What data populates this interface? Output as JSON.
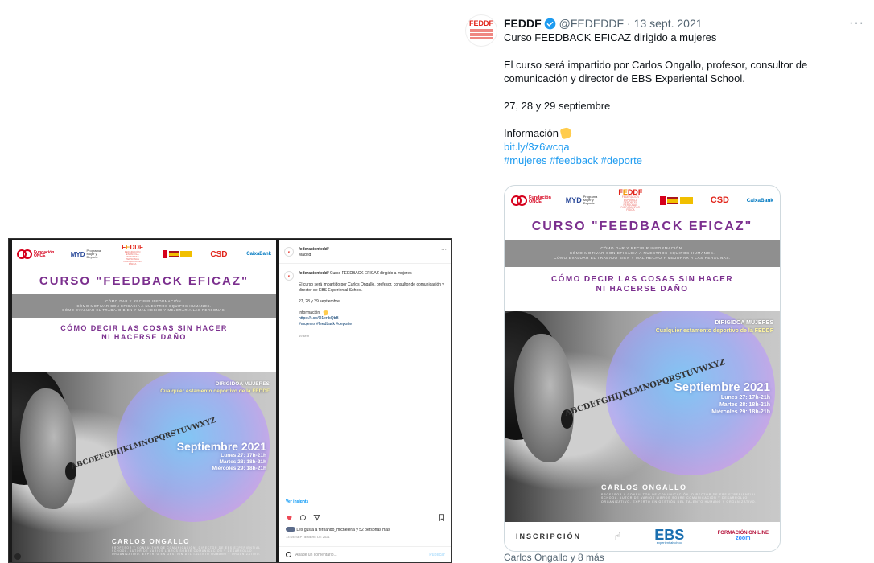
{
  "tweet": {
    "name": "FEDDF",
    "handle": "@FEDEDDF",
    "separator": "·",
    "date": "13 sept. 2021",
    "more_label": "···",
    "title_line": "Curso FEEDBACK EFICAZ dirigido a mujeres",
    "paragraph": "El curso será impartido por Carlos Ongallo, profesor, consultor de comunicación y director de EBS Experiental School.",
    "dates": "27, 28 y 29 septiembre",
    "info_label": "Información",
    "link": "bit.ly/3z6wcqa",
    "hashtags": "#mujeres #feedback #deporte",
    "tagged": "Carlos Ongallo y 8 más",
    "avatar_logo_text": "FEDDF"
  },
  "poster": {
    "logo_once": "Fundación ONCE",
    "logo_myd": "MYD",
    "logo_myd_sub": "Programa Mujer y Deporte",
    "logo_feddf": "FEDDF",
    "logo_feddf_sub": "FEDERACIÓN ESPAÑOLA DEPORTES PERSONAS DISCAPACIDAD FÍSICA",
    "logo_csd": "CSD",
    "logo_caixa": "CaixaBank",
    "title": "CURSO \"FEEDBACK EFICAZ\"",
    "band_line1": "CÓMO DAR Y RECIBIR INFORMACIÓN.",
    "band_line2": "CÓMO MOTIVAR CON EFICACIA A NUESTROS EQUIPOS HUMANOS.",
    "band_line3": "CÓMO EVALUAR EL TRABAJO BIEN Y MAL HECHO Y MEJORAR A LAS PERSONAS.",
    "subtitle_line1": "CÓMO DECIR LAS COSAS SIN HACER",
    "subtitle_line2": "NI HACERSE DAÑO",
    "dirigida": "DIRIGIDOA MUJERES",
    "estamento": "Cualquier estamento deportivo de la  FEDDF",
    "month": "Septiembre 2021",
    "day1": "Lunes 27: 17h-21h",
    "day2": "Martes 28: 18h-21h",
    "day3": "Miércoles 29: 18h-21h",
    "speaker": "CARLOS ONGALLO",
    "speaker_bio": "PROFESOR Y CONSULTOR DE COMUNICACIÓN. DIRECTOR DE EBS EXPERIENTIAL SCHOOL. AUTOR DE VARIOS LIBROS SOBRE COMUNICACIÓN Y DESARROLLO ORGANIZATIVO. EXPERTO EN GESTIÓN DEL TALENTO HUMANO Y ORGANIZATIVO.",
    "inscripcion": "INSCRIPCIÓN",
    "ebs": "EBS",
    "ebs_sub": "experientialschool",
    "formacion": "FORMACIÓN ON-LINE",
    "zoom": "zoom",
    "letters": "ABCDEFGHIJKLMNOPQRSTUVWXYZ"
  },
  "instagram": {
    "account": "federacionfeddf",
    "location": "Madrid",
    "more_label": "···",
    "caption_intro": "Curso FEEDBACK EFICAZ dirigido a mujeres",
    "caption_body": "El curso será impartido por Carlos Ongallo, profesor, consultor de comunicación y director de EBS Experiental School.",
    "caption_dates": "27, 28 y 29 septiembre",
    "caption_info": "Información",
    "caption_link": "https://t.co/O1ertbQbB",
    "caption_tags": "#mujeres #feedback #deporte",
    "caption_age": "19 sem",
    "insights": "Ver insights",
    "likes": "Les gusta a fernando_michelena y 52 personas más",
    "date": "13 DE SEPTIEMBRE DE 2021",
    "comment_placeholder": "Añade un comentario...",
    "publish": "Publicar"
  },
  "colors": {
    "twitter_blue": "#1d9bf0",
    "poster_purple": "#7b2f8e",
    "feddf_red": "#e1251b",
    "feddf_orange": "#f29400"
  }
}
